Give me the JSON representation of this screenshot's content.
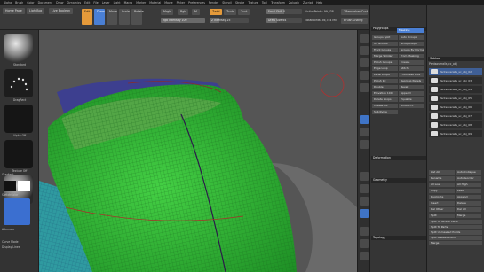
{
  "menu": [
    "Alpha",
    "Brush",
    "Color",
    "Document",
    "Draw",
    "Dynamics",
    "Edit",
    "File",
    "Layer",
    "Light",
    "Macro",
    "Marker",
    "Material",
    "Movie",
    "Picker",
    "Preferences",
    "Render",
    "Stencil",
    "Stroke",
    "Texture",
    "Tool",
    "Transform",
    "Zplugin",
    "Zscript",
    "Help"
  ],
  "toolbar": {
    "home_page": "Home Page",
    "lightbox": "LightBox",
    "live_boolean": "Live Boolean",
    "edit": "Edit",
    "draw": "Draw",
    "move": "Move",
    "scale": "Scale",
    "rotate": "Rotate",
    "mrgb": "Mrgb",
    "rgb": "Rgb",
    "m": "M",
    "zadd": "Zadd",
    "zsub": "Zsub",
    "zcut": "Zcut",
    "focal_shift_label": "Focal Shift 0",
    "draw_size_label": "Draw Size 64",
    "z_intensity_label": "Z Intensity 25",
    "rgb_intensity_label": "Rgb Intensity 100",
    "active_points": "ActivePoints: 99,438",
    "total_points": "TotalPoints: 36,744 Mil",
    "zremesher": "ZRemesher Custom 2D",
    "brush_listing": "Brush Listing"
  },
  "leftshelf": {
    "brush_name": "Standard",
    "stroke_name": "DragRect",
    "alpha_name": "Alpha Off",
    "texture_name": "Texture Off",
    "material_name": "SkinShade4",
    "gradient": "Gradient",
    "switch_color": "SwitchColor",
    "alternate": "Alternate",
    "curve_mode": "Curve Mode",
    "display_lines": "Display Lines"
  },
  "panel1": {
    "groups_title": "Polygroups",
    "rows": [
      "Groups Split",
      "Auto Groups",
      "Uv Groups",
      "Group Loops",
      "Front Groups",
      "Groups By Normals",
      "Merge Similar",
      "From Masking",
      "Polish Groups",
      "Crease",
      "Edge Loop",
      "Stitch",
      "Panel Loops",
      "Thickness 0.02",
      "Polish 10",
      "Regroup Panels",
      "Double",
      "Bevel",
      "Elevation 100",
      "Append",
      "Delete Loops",
      "Equalize",
      "Crease PG",
      "Smooth 0",
      "Subdivide"
    ],
    "masking": "Masking",
    "section_deformation": "Deformation",
    "section_geometry": "Geometry",
    "section_topology": "Topology"
  },
  "panel2": {
    "section_title": "Subtool",
    "list_title": "Pantsoveralls_cc_obj",
    "subtools": [
      "Pantsoveralls_sc_obj_02",
      "Pantsoveralls_sc_obj_03",
      "Pantsoveralls_sc_obj_04",
      "Pantsoveralls_sc_obj_05",
      "Pantsoveralls_sc_obj_06",
      "Pantsoveralls_sc_obj_07",
      "Pantsoveralls_sc_obj_08",
      "Pantsoveralls_sc_obj_09"
    ],
    "buttons": [
      "List All",
      "Auto Collapse",
      "Rename",
      "AutoReorder",
      "All Low",
      "All High",
      "Copy",
      "Paste",
      "Duplicate",
      "Append",
      "Insert",
      "Delete",
      "Del Other",
      "Del All",
      "Split",
      "Merge",
      "Split To Similar Parts",
      "Split To Parts",
      "Split Unmasked Points",
      "Split Masked Points"
    ],
    "merge_label": "Merge"
  },
  "colors": {
    "accent": "#e59a3a",
    "select_blue": "#4a7fd4",
    "mesh_green": "#2fbf36",
    "mesh_teal": "#2f9aa0",
    "bg": "#555555"
  }
}
